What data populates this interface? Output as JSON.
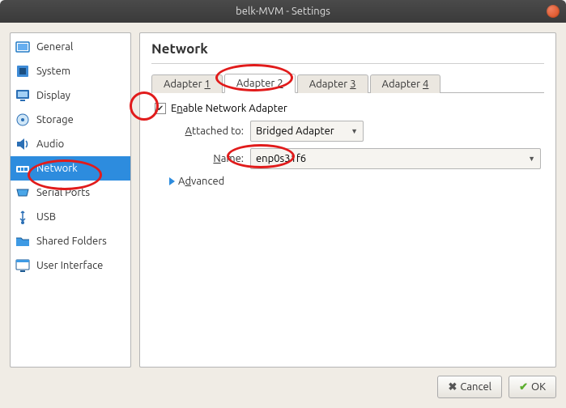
{
  "window_title": "belk-MVM - Settings",
  "sidebar": {
    "items": [
      {
        "label": "General"
      },
      {
        "label": "System"
      },
      {
        "label": "Display"
      },
      {
        "label": "Storage"
      },
      {
        "label": "Audio"
      },
      {
        "label": "Network",
        "selected": true
      },
      {
        "label": "Serial Ports"
      },
      {
        "label": "USB"
      },
      {
        "label": "Shared Folders"
      },
      {
        "label": "User Interface"
      }
    ]
  },
  "page_title": "Network",
  "tabs": [
    {
      "pre": "Adapter ",
      "ukey": "1"
    },
    {
      "pre": "Adapter ",
      "ukey": "2",
      "active": true
    },
    {
      "pre": "Adapter ",
      "ukey": "3"
    },
    {
      "pre": "Adapter ",
      "ukey": "4"
    }
  ],
  "enable_label_pre": "E",
  "enable_label_u": "n",
  "enable_label_post": "able Network Adapter",
  "enable_checked": true,
  "attached_label_u": "A",
  "attached_label_post": "ttached to:",
  "attached_value": "Bridged Adapter",
  "name_label_u": "N",
  "name_label_post": "ame:",
  "name_value": "enp0s31f6",
  "advanced_label_u": "d",
  "advanced_label_pre": "A",
  "advanced_label_post": "vanced",
  "buttons": {
    "cancel": "Cancel",
    "ok": "OK"
  }
}
